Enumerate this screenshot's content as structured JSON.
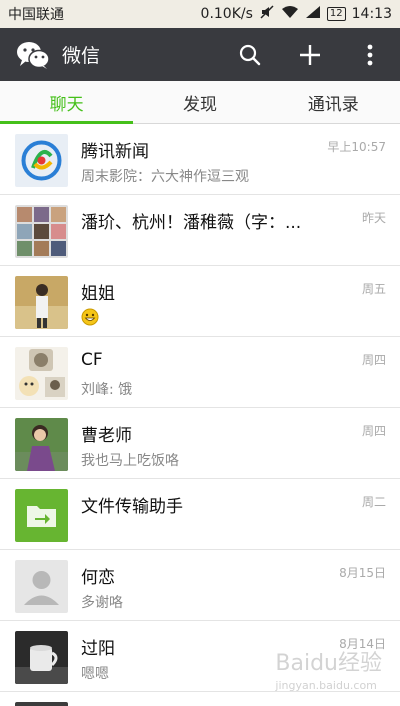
{
  "status_bar": {
    "carrier": "中国联通",
    "speed": "0.10K/s",
    "battery": "12",
    "time": "14:13"
  },
  "app_bar": {
    "title": "微信",
    "icons": [
      "wechat-logo-icon",
      "search-icon",
      "plus-icon",
      "more-icon"
    ]
  },
  "tabs": [
    {
      "label": "聊天",
      "active": true
    },
    {
      "label": "发现",
      "active": false
    },
    {
      "label": "通讯录",
      "active": false
    }
  ],
  "chats": [
    {
      "name": "腾讯新闻",
      "message": "周末影院：六大神作逗三观",
      "time": "早上10:57"
    },
    {
      "name": "潘玠、杭州！潘稚薇（字：...",
      "message": "",
      "time": "昨天"
    },
    {
      "name": "姐姐",
      "message": "",
      "time": "周五"
    },
    {
      "name": "CF",
      "message": "刘峰: 饿",
      "time": "周四"
    },
    {
      "name": "曹老师",
      "message": "我也马上吃饭咯",
      "time": "周四"
    },
    {
      "name": "文件传输助手",
      "message": "",
      "time": "周二"
    },
    {
      "name": "何恋",
      "message": "多谢咯",
      "time": "8月15日"
    },
    {
      "name": "过阳",
      "message": "嗯嗯",
      "time": "8月14日"
    }
  ],
  "watermark": {
    "text": "Baidu经验",
    "sub": "jingyan.baidu.com"
  },
  "colors": {
    "accent": "#45c01a",
    "app_bar": "#393a3f"
  }
}
